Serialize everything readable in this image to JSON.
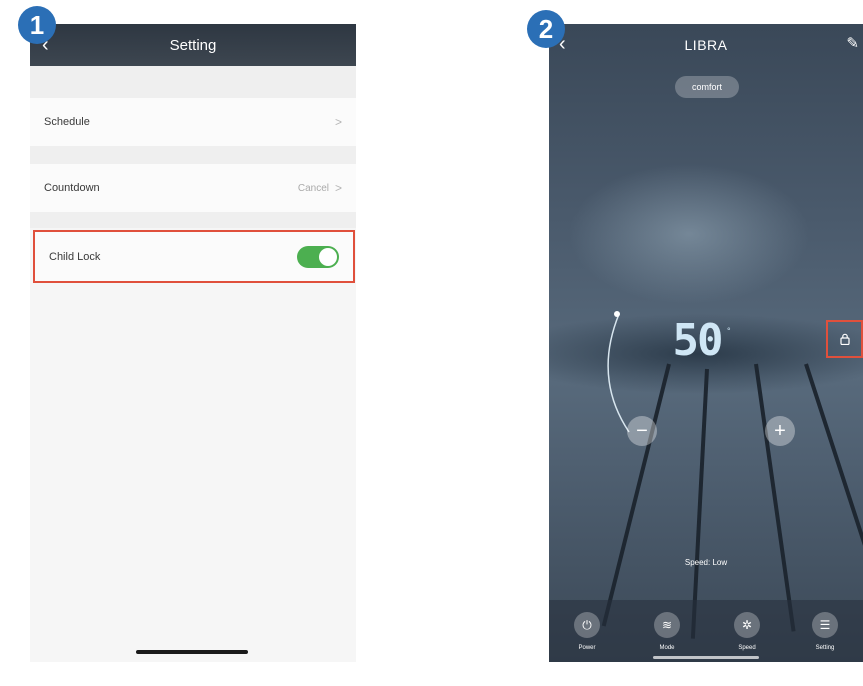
{
  "step_badges": [
    "1",
    "2"
  ],
  "screen1": {
    "header": {
      "back_icon": "‹",
      "title": "Setting"
    },
    "rows": {
      "schedule": {
        "label": "Schedule",
        "chevron": ">"
      },
      "countdown": {
        "label": "Countdown",
        "value": "Cancel",
        "chevron": ">"
      },
      "child_lock": {
        "label": "Child Lock",
        "toggle_on": true
      }
    },
    "colors": {
      "toggle_on": "#4caf50",
      "highlight": "#e0503c"
    }
  },
  "screen2": {
    "header": {
      "back_icon": "‹",
      "title": "LIBRA",
      "edit_icon": "✎"
    },
    "mode_pill": "comfort",
    "temperature": {
      "value": "50",
      "unit": "°"
    },
    "controls": {
      "minus": "−",
      "plus": "+"
    },
    "speed_label": "Speed: Low",
    "bottom_bar": [
      {
        "icon": "power-icon",
        "glyph": "⏻",
        "label": "Power"
      },
      {
        "icon": "mode-icon",
        "glyph": "≋",
        "label": "Mode"
      },
      {
        "icon": "fan-icon",
        "glyph": "✲",
        "label": "Speed"
      },
      {
        "icon": "setting-icon",
        "glyph": "☰",
        "label": "Setting"
      }
    ],
    "lock_icon_glyph": "🔒"
  }
}
